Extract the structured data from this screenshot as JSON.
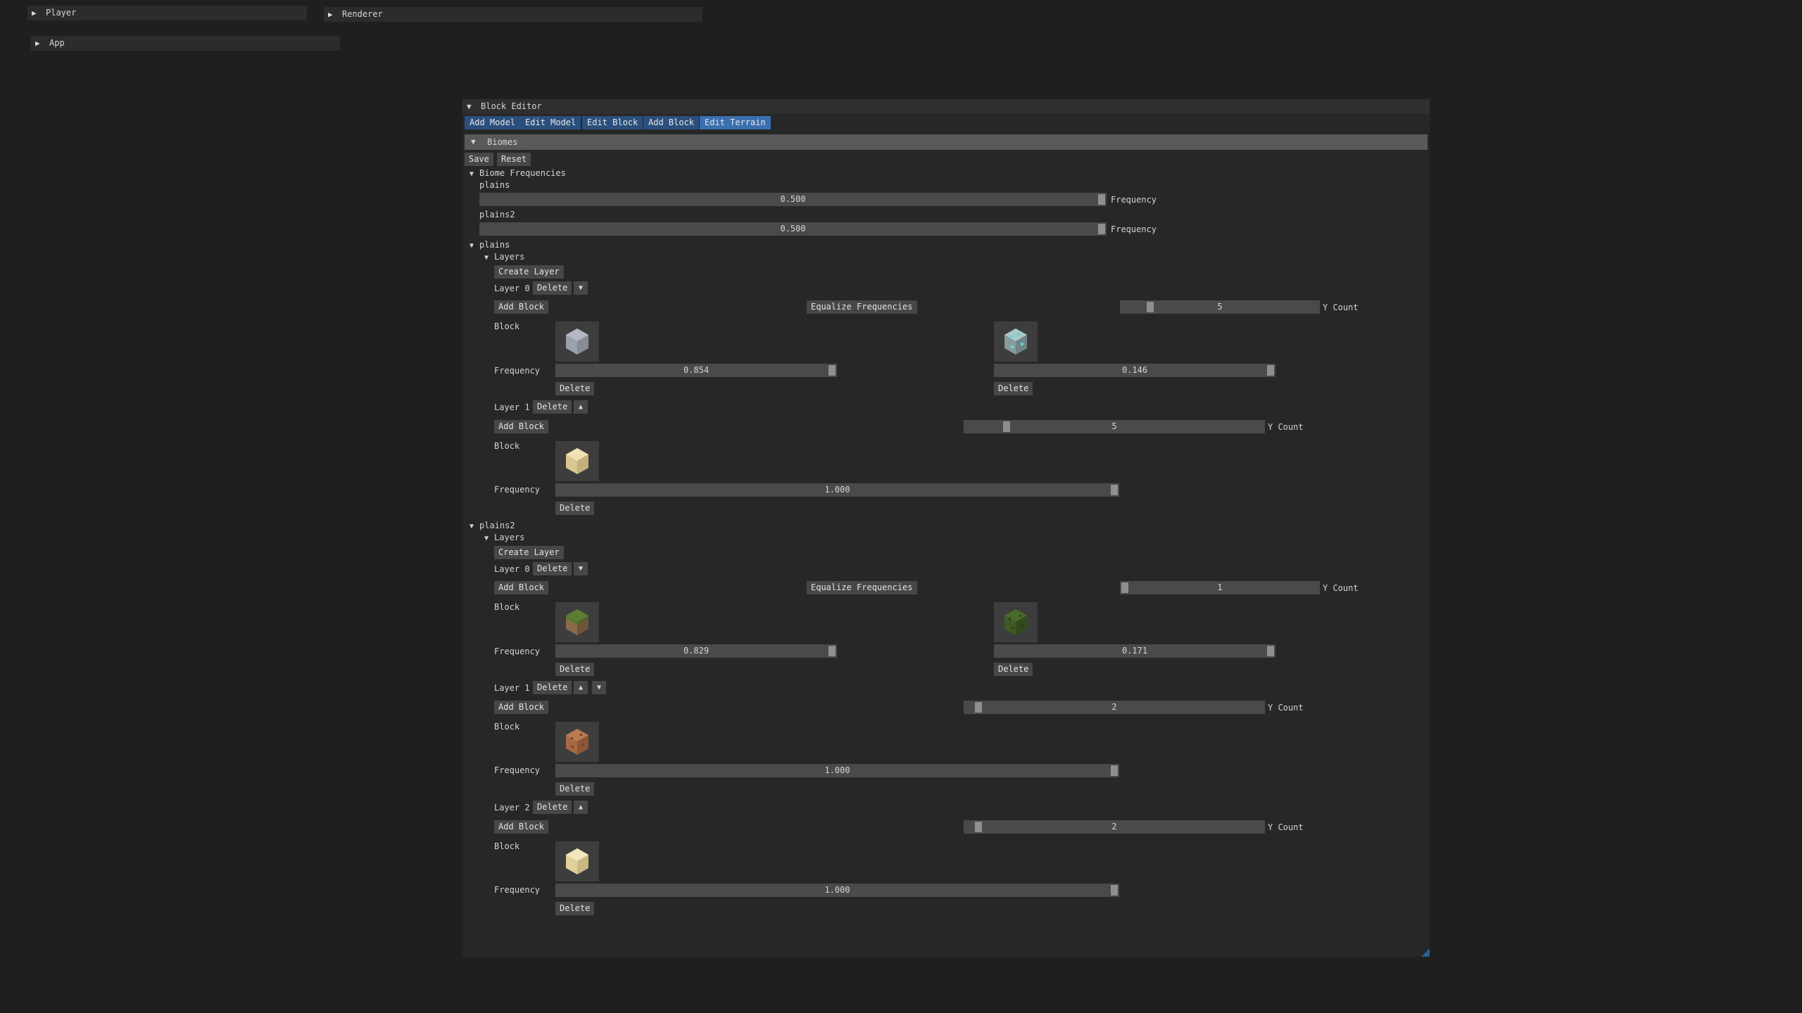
{
  "panels": {
    "player": {
      "label": "Player"
    },
    "renderer": {
      "label": "Renderer"
    },
    "app": {
      "label": "App"
    }
  },
  "window": {
    "title": "Block Editor",
    "tabs": [
      {
        "label": "Add Model"
      },
      {
        "label": "Edit Model"
      },
      {
        "label": "Edit Block"
      },
      {
        "label": "Add Block"
      },
      {
        "label": "Edit Terrain",
        "active": true
      }
    ]
  },
  "biomes": {
    "header": "Biomes",
    "save": "Save",
    "reset": "Reset",
    "frequencies": {
      "header": "Biome Frequencies",
      "items": [
        {
          "name": "plains",
          "value": "0.500",
          "label": "Frequency"
        },
        {
          "name": "plains2",
          "value": "0.500",
          "label": "Frequency"
        }
      ]
    }
  },
  "labels": {
    "layers": "Layers",
    "create_layer": "Create Layer",
    "delete": "Delete",
    "add_block": "Add Block",
    "equalize": "Equalize Frequencies",
    "y_count": "Y Count",
    "block": "Block",
    "frequency": "Frequency"
  },
  "plains": {
    "name": "plains",
    "layers": [
      {
        "label": "Layer 0",
        "y_count": "5",
        "blocks": [
          {
            "icon": "stone-block-icon",
            "color": "#9aa0ad",
            "frequency": "0.854"
          },
          {
            "icon": "diamond-ore-block-icon",
            "color": "#7fb3b3",
            "frequency": "0.146"
          }
        ]
      },
      {
        "label": "Layer 1",
        "y_count": "5",
        "blocks": [
          {
            "icon": "sand-block-icon",
            "color": "#e0cf9a",
            "frequency": "1.000"
          }
        ]
      }
    ]
  },
  "plains2": {
    "name": "plains2",
    "layers": [
      {
        "label": "Layer 0",
        "y_count": "1",
        "blocks": [
          {
            "icon": "grass-block-icon",
            "color": "#8a6a48",
            "frequency": "0.829"
          },
          {
            "icon": "leaves-block-icon",
            "color": "#3f5a24",
            "frequency": "0.171"
          }
        ]
      },
      {
        "label": "Layer 1",
        "y_count": "2",
        "blocks": [
          {
            "icon": "dirt-block-icon",
            "color": "#a56a45",
            "frequency": "1.000"
          }
        ]
      },
      {
        "label": "Layer 2",
        "y_count": "2",
        "blocks": [
          {
            "icon": "sand-block-icon",
            "color": "#e8d8a8",
            "frequency": "1.000"
          }
        ]
      }
    ]
  }
}
